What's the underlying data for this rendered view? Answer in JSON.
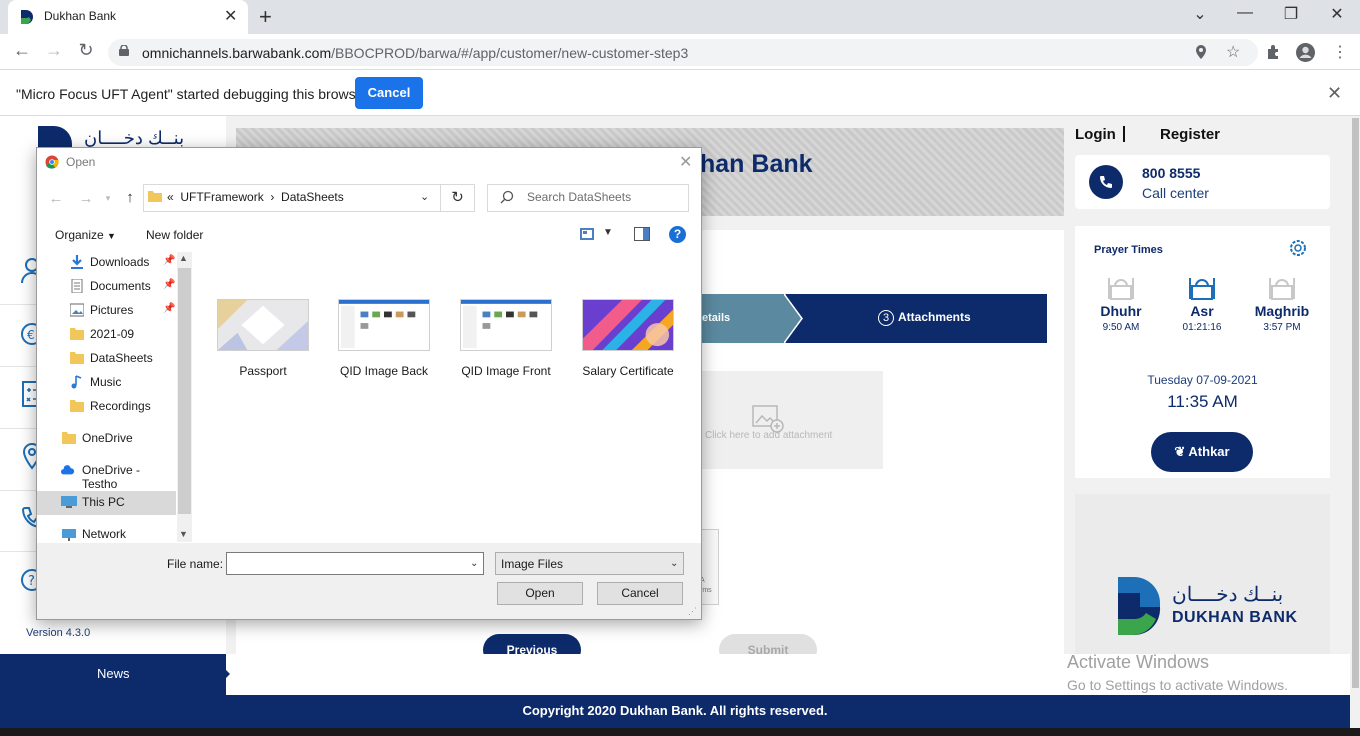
{
  "browser": {
    "tab_title": "Dukhan Bank",
    "url_host": "omnichannels.barwabank.com",
    "url_path": "/BBOCPROD/barwa/#/app/customer/new-customer-step3"
  },
  "debug_bar": {
    "message": "\"Micro Focus UFT Agent\" started debugging this browser",
    "cancel_label": "Cancel"
  },
  "site": {
    "banner_title_visible": "han Bank",
    "version": "Version 4.3.0",
    "login": "Login",
    "register": "Register",
    "call_number": "800 8555",
    "call_label": "Call center",
    "steps": {
      "step2_partial": "etails",
      "step3_number": "3",
      "step3_label": "Attachments"
    },
    "attach_hint": "Click here to add attachment",
    "captcha_partial": "A\nrms",
    "previous": "Previous",
    "submit": "Submit",
    "prayer": {
      "title": "Prayer Times",
      "times": [
        {
          "name": "Dhuhr",
          "time": "9:50 AM"
        },
        {
          "name": "Asr",
          "time": "01:21:16"
        },
        {
          "name": "Maghrib",
          "time": "3:57 PM"
        }
      ],
      "date": "Tuesday 07-09-2021",
      "clock": "11:35 AM",
      "athkar": "Athkar"
    },
    "logo": {
      "arabic": "بنــك دخــــان",
      "english": "DUKHAN BANK"
    },
    "news_label": "News",
    "copyright": "Copyright 2020 Dukhan Bank. All rights reserved.",
    "activate_title": "Activate Windows",
    "activate_sub": "Go to Settings to activate Windows.",
    "accent": "#0d2b6b"
  },
  "dialog": {
    "title": "Open",
    "path": [
      "UFTFramework",
      "DataSheets"
    ],
    "path_prefix": "«",
    "search_placeholder": "Search DataSheets",
    "organize": "Organize",
    "new_folder": "New folder",
    "nav_items": [
      {
        "label": "Downloads",
        "icon": "download-icon",
        "pinned": true
      },
      {
        "label": "Documents",
        "icon": "documents-icon",
        "pinned": true
      },
      {
        "label": "Pictures",
        "icon": "pictures-icon",
        "pinned": true
      },
      {
        "label": "2021-09",
        "icon": "folder-icon",
        "pinned": false
      },
      {
        "label": "DataSheets",
        "icon": "folder-icon",
        "pinned": false
      },
      {
        "label": "Music",
        "icon": "music-icon",
        "pinned": false
      },
      {
        "label": "Recordings",
        "icon": "folder-icon",
        "pinned": false
      },
      {
        "label": "OneDrive",
        "icon": "folder-icon",
        "pinned": false
      },
      {
        "label": "OneDrive - Testho",
        "icon": "cloud-icon",
        "pinned": false
      },
      {
        "label": "This PC",
        "icon": "pc-icon",
        "pinned": false
      },
      {
        "label": "Network",
        "icon": "network-icon",
        "pinned": false
      }
    ],
    "files": [
      {
        "label": "Passport"
      },
      {
        "label": "QID Image Back"
      },
      {
        "label": "QID Image Front"
      },
      {
        "label": "Salary Certificate"
      }
    ],
    "file_name_label": "File name:",
    "file_name_value": "",
    "file_type": "Image Files",
    "open_label": "Open",
    "cancel_label": "Cancel"
  }
}
